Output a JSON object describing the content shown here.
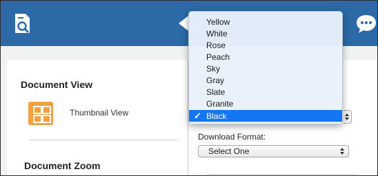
{
  "left_panel": {
    "document_view_title": "Document View",
    "thumbnail_label": "Thumbnail View",
    "document_zoom_title": "Document Zoom"
  },
  "right_panel": {
    "download_format_label": "Download Format:",
    "download_format_select": "Select One"
  },
  "dropdown": {
    "selected": "Black",
    "check_glyph": "✓",
    "options": [
      "Yellow",
      "White",
      "Rose",
      "Peach",
      "Sky",
      "Gray",
      "Slate",
      "Granite",
      "Black"
    ]
  },
  "colors": {
    "header": "#2b6aa6",
    "accent_orange": "#f3a040",
    "selection_blue": "#1476f2"
  },
  "icons": {
    "header_left": "document-search-icon",
    "header_center": "back-arrow-icon",
    "header_right": "chat-bubble-icon",
    "thumbnail": "grid-icon"
  }
}
